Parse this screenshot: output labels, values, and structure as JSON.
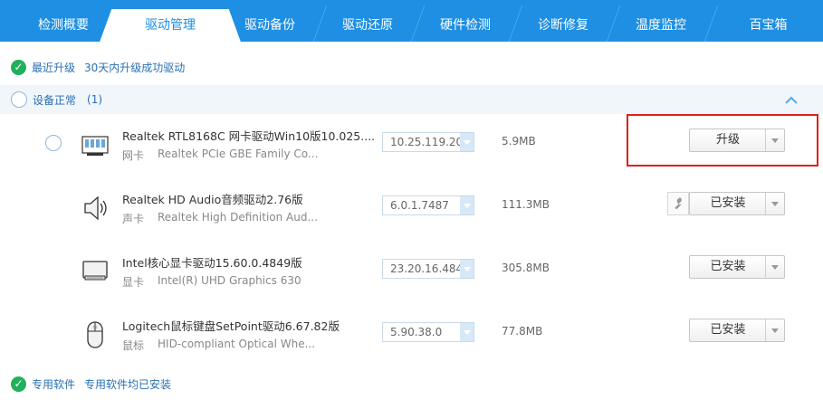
{
  "tabs": [
    {
      "label": "检测概要"
    },
    {
      "label": "驱动管理"
    },
    {
      "label": "驱动备份"
    },
    {
      "label": "驱动还原"
    },
    {
      "label": "硬件检测"
    },
    {
      "label": "诊断修复"
    },
    {
      "label": "温度监控"
    },
    {
      "label": "百宝箱"
    }
  ],
  "active_tab": "驱动管理",
  "recent": {
    "label": "最近升级",
    "note": "30天内升级成功驱动"
  },
  "group": {
    "title": "设备正常",
    "count": "(1)"
  },
  "devices": [
    {
      "name": "Realtek RTL8168C 网卡驱动Win10版10.025....",
      "type": "网卡",
      "model": "Realtek PCIe GBE Family Co...",
      "version": "10.25.119.20",
      "size": "5.9MB",
      "action": "升级",
      "icon": "network-card-icon"
    },
    {
      "name": "Realtek HD Audio音频驱动2.76版",
      "type": "声卡",
      "model": "Realtek High Definition Aud...",
      "version": "6.0.1.7487",
      "size": "111.3MB",
      "action": "已安装",
      "icon": "speaker-icon"
    },
    {
      "name": "Intel核心显卡驱动15.60.0.4849版",
      "type": "显卡",
      "model": "Intel(R) UHD Graphics 630",
      "version": "23.20.16.484",
      "size": "305.8MB",
      "action": "已安装",
      "icon": "monitor-icon"
    },
    {
      "name": "Logitech鼠标键盘SetPoint驱动6.67.82版",
      "type": "鼠标",
      "model": "HID-compliant Optical Whe...",
      "version": "5.90.38.0",
      "size": "77.8MB",
      "action": "已安装",
      "icon": "mouse-icon"
    }
  ],
  "software": {
    "label": "专用软件",
    "note": "专用软件均已安装"
  },
  "colors": {
    "tabbar": "#1e8fe3",
    "link": "#2a6fb3",
    "ok": "#21b05b",
    "highlight": "#d9231d"
  }
}
